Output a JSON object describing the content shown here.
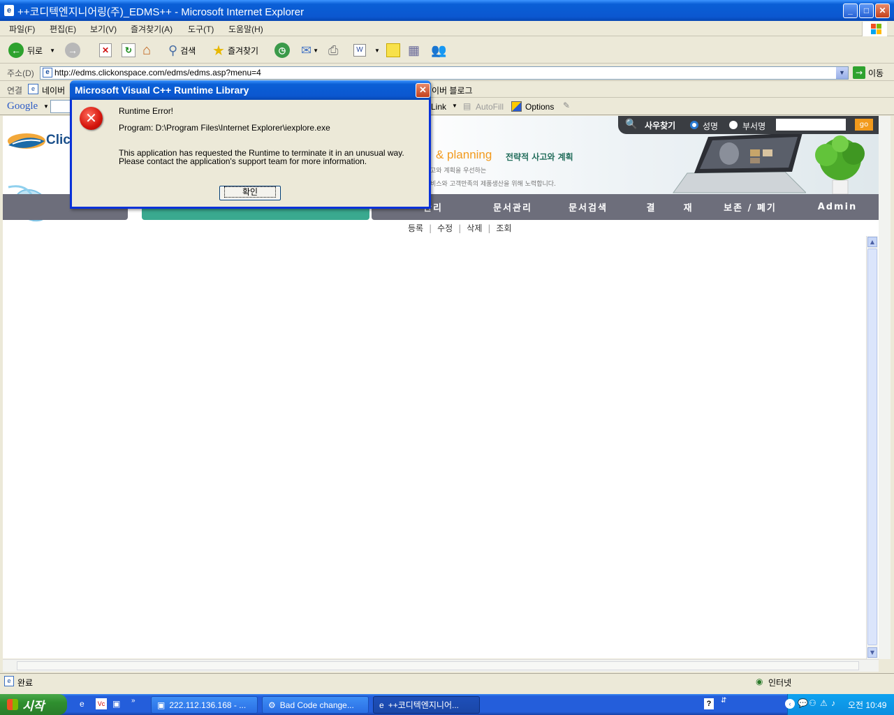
{
  "window": {
    "title": "++코디텍엔지니어링(주)_EDMS++ - Microsoft Internet Explorer"
  },
  "menu": [
    "파일(F)",
    "편집(E)",
    "보기(V)",
    "즐겨찾기(A)",
    "도구(T)",
    "도움말(H)"
  ],
  "toolbar": {
    "back": "뒤로",
    "search": "검색",
    "favorites": "즐겨찾기"
  },
  "address": {
    "label": "주소(D)",
    "url": "http://edms.clickonspace.com/edms/edms.asp?menu=4",
    "go": "이동"
  },
  "links": {
    "label": "연결",
    "item1": "네이버",
    "item2": "이버 블로그"
  },
  "googlebar": {
    "brand": "Google",
    "link": "Link",
    "autofill": "AutoFill",
    "options": "Options"
  },
  "site": {
    "logo": "Click",
    "slogan_en": "& planning",
    "slogan_ko": "전략적 사고와 계획",
    "line1": "고와 계획을 우선하는",
    "line2": "비스와 고객만족의 제품생산을 위해 노력합니다.",
    "search_title": "사우찾기",
    "radio_name": "성명",
    "radio_dept": "부서명",
    "go": "go"
  },
  "nav": [
    "관리",
    "문서관리",
    "문서검색",
    "결      재",
    "보존 / 폐기",
    "Admin"
  ],
  "subnav": [
    "등록",
    "수정",
    "삭제",
    "조회"
  ],
  "status": {
    "text": "완료",
    "zone": "인터넷"
  },
  "taskbar": {
    "start": "시작",
    "tasks": [
      "222.112.136.168 - ...",
      "Bad Code change...",
      "++코디텍엔지니어..."
    ],
    "clock": "오전 10:49"
  },
  "dialog": {
    "title": "Microsoft Visual C++ Runtime Library",
    "error_title": "Runtime Error!",
    "program": "Program: D:\\Program Files\\Internet Explorer\\iexplore.exe",
    "message1": "This application has requested the Runtime to terminate it in an unusual way.",
    "message2": "Please contact the application's support team for more information.",
    "ok": "확인"
  },
  "colors": {
    "xp_blue": "#0a5fd6",
    "nav_gray": "#6d6e7b",
    "nav_teal": "#3aa98f",
    "orange": "#f29a1c"
  }
}
